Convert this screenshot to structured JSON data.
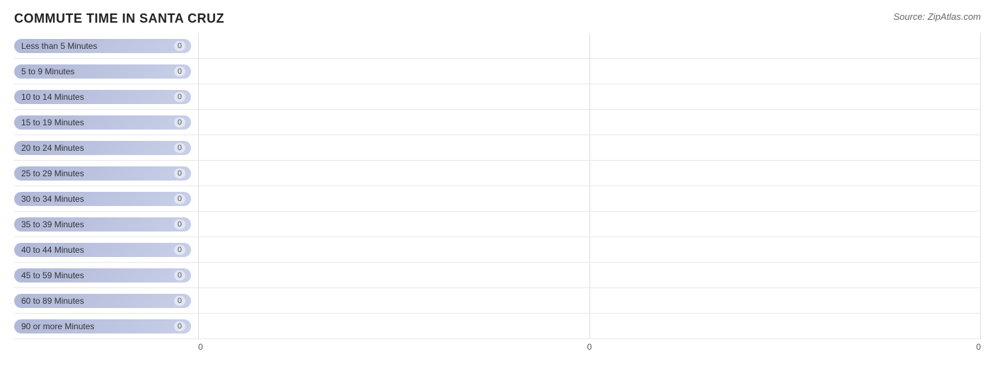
{
  "header": {
    "title": "COMMUTE TIME IN SANTA CRUZ",
    "source": "Source: ZipAtlas.com"
  },
  "chart": {
    "bars": [
      {
        "label": "Less than 5 Minutes",
        "value": 0
      },
      {
        "label": "5 to 9 Minutes",
        "value": 0
      },
      {
        "label": "10 to 14 Minutes",
        "value": 0
      },
      {
        "label": "15 to 19 Minutes",
        "value": 0
      },
      {
        "label": "20 to 24 Minutes",
        "value": 0
      },
      {
        "label": "25 to 29 Minutes",
        "value": 0
      },
      {
        "label": "30 to 34 Minutes",
        "value": 0
      },
      {
        "label": "35 to 39 Minutes",
        "value": 0
      },
      {
        "label": "40 to 44 Minutes",
        "value": 0
      },
      {
        "label": "45 to 59 Minutes",
        "value": 0
      },
      {
        "label": "60 to 89 Minutes",
        "value": 0
      },
      {
        "label": "90 or more Minutes",
        "value": 0
      }
    ],
    "xLabels": [
      "0",
      "0",
      "0"
    ],
    "maxValue": 1
  }
}
